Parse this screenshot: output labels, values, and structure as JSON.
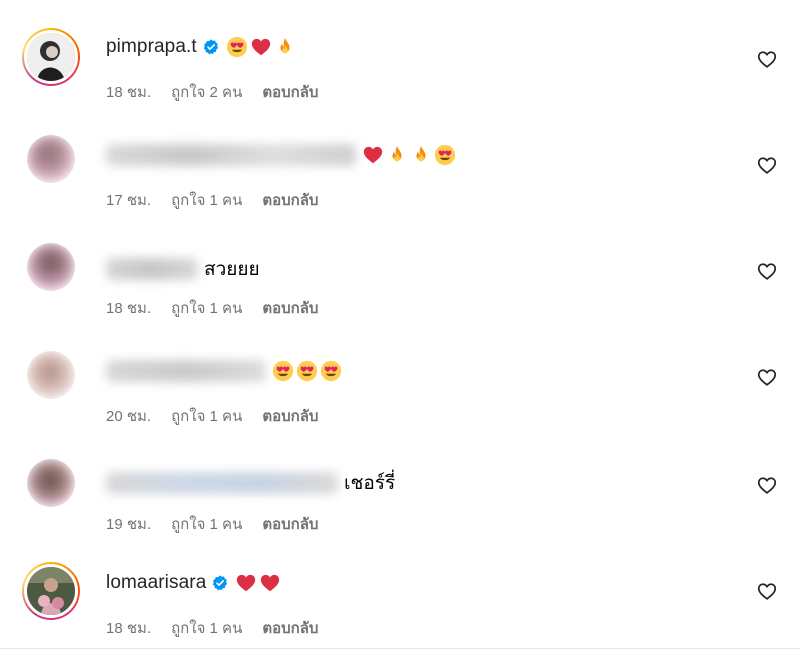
{
  "comments": [
    {
      "username": "pimprapa.t",
      "verified": true,
      "text": "",
      "emojis": [
        "heart-eyes-emoji",
        "red-heart-emoji",
        "fire-emoji"
      ],
      "time": "18 ชม.",
      "likes": "ถูกใจ 2 คน",
      "reply": "ตอบกลับ"
    },
    {
      "username": "",
      "verified": false,
      "text": "",
      "emojis": [
        "red-heart-emoji",
        "fire-emoji",
        "fire-emoji",
        "heart-eyes-emoji"
      ],
      "time": "17 ชม.",
      "likes": "ถูกใจ 1 คน",
      "reply": "ตอบกลับ"
    },
    {
      "username": "",
      "verified": false,
      "text": "สวยยย",
      "emojis": [],
      "time": "18 ชม.",
      "likes": "ถูกใจ 1 คน",
      "reply": "ตอบกลับ"
    },
    {
      "username": "",
      "verified": false,
      "text": "",
      "emojis": [
        "heart-eyes-emoji",
        "heart-eyes-emoji",
        "heart-eyes-emoji"
      ],
      "time": "20 ชม.",
      "likes": "ถูกใจ 1 คน",
      "reply": "ตอบกลับ"
    },
    {
      "username": "",
      "verified": false,
      "text": "เชอร์รี่",
      "emojis": [],
      "time": "19 ชม.",
      "likes": "ถูกใจ 1 คน",
      "reply": "ตอบกลับ"
    },
    {
      "username": "lomaarisara",
      "verified": true,
      "text": "",
      "emojis": [
        "red-heart-emoji",
        "red-heart-emoji"
      ],
      "time": "18 ชม.",
      "likes": "ถูกใจ 1 คน",
      "reply": "ตอบกลับ"
    }
  ],
  "colors": {
    "verified": "#0095f6",
    "meta_text": "#737373",
    "heart_outline": "#262626"
  }
}
